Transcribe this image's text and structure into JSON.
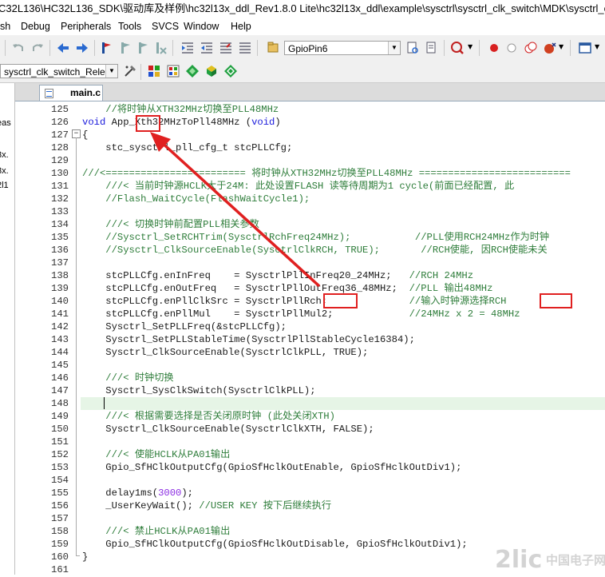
{
  "window": {
    "title": "C32L136\\HC32L136_SDK\\驱动库及样例\\hc32l13x_ddl_Rev1.8.0 Lite\\hc32l13x_ddl\\example\\sysctrl\\sysctrl_clk_switch\\MDK\\sysctrl_clk_sw"
  },
  "menu": [
    "sh",
    "Debug",
    "Peripherals",
    "Tools",
    "SVCS",
    "Window",
    "Help"
  ],
  "toolbar": {
    "find_combo_value": "GpioPin6",
    "target_combo_value": "sysctrl_clk_switch_Releas"
  },
  "left_panel": [
    "eas",
    "3x.",
    "3x.",
    "2l1"
  ],
  "tab": {
    "label": "main.c"
  },
  "code_lines": [
    {
      "n": "125",
      "segs": [
        {
          "t": "    //将时钟从XTH32MHz切换至PLL48MHz",
          "c": "com"
        }
      ]
    },
    {
      "n": "126",
      "segs": [
        {
          "t": "void",
          "c": "kw"
        },
        {
          "t": " App_Xth32MHzToPll48MHz (",
          "c": ""
        },
        {
          "t": "void",
          "c": "kw"
        },
        {
          "t": ")",
          "c": ""
        }
      ]
    },
    {
      "n": "127",
      "segs": [
        {
          "t": "{",
          "c": ""
        }
      ]
    },
    {
      "n": "128",
      "segs": [
        {
          "t": "    stc_sysctrl_pll_cfg_t stcPLLCfg;",
          "c": ""
        }
      ]
    },
    {
      "n": "129",
      "segs": [
        {
          "t": "",
          "c": ""
        }
      ]
    },
    {
      "n": "130",
      "segs": [
        {
          "t": "///<======================== 将时钟从XTH32MHz切换至PLL48MHz ==========================",
          "c": "com"
        }
      ]
    },
    {
      "n": "131",
      "segs": [
        {
          "t": "    ///< 当前时钟源HCLK大于24M: 此处设置FLASH 读等待周期为1 cycle(前面已经配置, 此",
          "c": "com"
        }
      ]
    },
    {
      "n": "132",
      "segs": [
        {
          "t": "    //Flash_WaitCycle(FlashWaitCycle1);",
          "c": "com"
        }
      ]
    },
    {
      "n": "133",
      "segs": [
        {
          "t": "",
          "c": ""
        }
      ]
    },
    {
      "n": "134",
      "segs": [
        {
          "t": "    ///< 切换时钟前配置PLL相关参数",
          "c": "com"
        }
      ]
    },
    {
      "n": "135",
      "segs": [
        {
          "t": "    //Sysctrl_SetRCHTrim(SysctrlRchFreq24MHz);           //PLL使用RCH24MHz作为时钟",
          "c": "com"
        }
      ]
    },
    {
      "n": "136",
      "segs": [
        {
          "t": "    //Sysctrl_ClkSourceEnable(SysctrlClkRCH, TRUE);       //RCH使能, 因RCH使能未关",
          "c": "com"
        }
      ]
    },
    {
      "n": "137",
      "segs": [
        {
          "t": "",
          "c": ""
        }
      ]
    },
    {
      "n": "138",
      "segs": [
        {
          "t": "    stcPLLCfg.enInFreq    = SysctrlPllInFreq20_24MHz;   ",
          "c": ""
        },
        {
          "t": "//RCH 24MHz",
          "c": "com"
        }
      ]
    },
    {
      "n": "139",
      "segs": [
        {
          "t": "    stcPLLCfg.enOutFreq   = SysctrlPllOutFreq36_48MHz;  ",
          "c": ""
        },
        {
          "t": "//PLL 输出48MHz",
          "c": "com"
        }
      ]
    },
    {
      "n": "140",
      "segs": [
        {
          "t": "    stcPLLCfg.enPllClkSrc = SysctrlPllRch;              ",
          "c": ""
        },
        {
          "t": "//输入时钟源选择RCH",
          "c": "com"
        }
      ]
    },
    {
      "n": "141",
      "segs": [
        {
          "t": "    stcPLLCfg.enPllMul    = SysctrlPllMul2;             ",
          "c": ""
        },
        {
          "t": "//24MHz x 2 = 48MHz",
          "c": "com"
        }
      ]
    },
    {
      "n": "142",
      "segs": [
        {
          "t": "    Sysctrl_SetPLLFreq(&stcPLLCfg);",
          "c": ""
        }
      ]
    },
    {
      "n": "143",
      "segs": [
        {
          "t": "    Sysctrl_SetPLLStableTime(SysctrlPllStableCycle16384);",
          "c": ""
        }
      ]
    },
    {
      "n": "144",
      "segs": [
        {
          "t": "    Sysctrl_ClkSourceEnable(SysctrlClkPLL, TRUE);",
          "c": ""
        }
      ]
    },
    {
      "n": "145",
      "segs": [
        {
          "t": "",
          "c": ""
        }
      ]
    },
    {
      "n": "146",
      "segs": [
        {
          "t": "    ///< 时钟切换",
          "c": "com"
        }
      ]
    },
    {
      "n": "147",
      "segs": [
        {
          "t": "    Sysctrl_SysClkSwitch(SysctrlClkPLL);",
          "c": ""
        }
      ]
    },
    {
      "n": "148",
      "segs": [
        {
          "t": "",
          "c": ""
        }
      ]
    },
    {
      "n": "149",
      "segs": [
        {
          "t": "    ///< 根据需要选择是否关闭原时钟 (此处关闭XTH)",
          "c": "com"
        }
      ]
    },
    {
      "n": "150",
      "segs": [
        {
          "t": "    Sysctrl_ClkSourceEnable(SysctrlClkXTH, FALSE);",
          "c": ""
        }
      ]
    },
    {
      "n": "151",
      "segs": [
        {
          "t": "",
          "c": ""
        }
      ]
    },
    {
      "n": "152",
      "segs": [
        {
          "t": "    ///< 使能HCLK从PA01输出",
          "c": "com"
        }
      ]
    },
    {
      "n": "153",
      "segs": [
        {
          "t": "    Gpio_SfHClkOutputCfg(GpioSfHclkOutEnable, GpioSfHclkOutDiv1);",
          "c": ""
        }
      ]
    },
    {
      "n": "154",
      "segs": [
        {
          "t": "",
          "c": ""
        }
      ]
    },
    {
      "n": "155",
      "segs": [
        {
          "t": "    delay1ms(",
          "c": ""
        },
        {
          "t": "3000",
          "c": "num"
        },
        {
          "t": ");",
          "c": ""
        }
      ]
    },
    {
      "n": "156",
      "segs": [
        {
          "t": "    _UserKeyWait(); ",
          "c": ""
        },
        {
          "t": "//USER KEY 按下后继续执行",
          "c": "com"
        }
      ]
    },
    {
      "n": "157",
      "segs": [
        {
          "t": "",
          "c": ""
        }
      ]
    },
    {
      "n": "158",
      "segs": [
        {
          "t": "    ///< 禁止HCLK从PA01输出",
          "c": "com"
        }
      ]
    },
    {
      "n": "159",
      "segs": [
        {
          "t": "    Gpio_SfHClkOutputCfg(GpioSfHclkOutDisable, GpioSfHclkOutDiv1);",
          "c": ""
        }
      ]
    },
    {
      "n": "160",
      "segs": [
        {
          "t": "}",
          "c": ""
        }
      ]
    },
    {
      "n": "161",
      "segs": [
        {
          "t": "",
          "c": ""
        }
      ]
    }
  ],
  "colors": {
    "annotation": "#e02020",
    "comment": "#2e7d3a",
    "keyword": "#1a1adc",
    "current_line": "#e6f5e6"
  },
  "watermark": {
    "text": "中国电子网",
    "brand": "2lic"
  }
}
